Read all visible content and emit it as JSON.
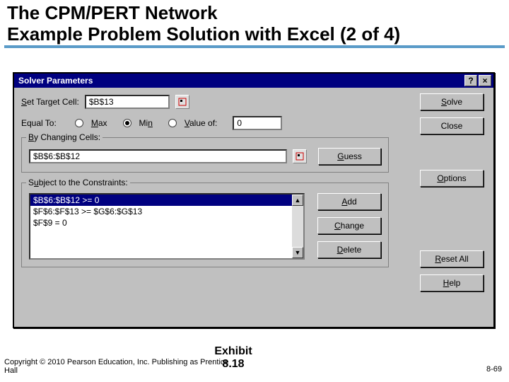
{
  "slide": {
    "title": "The CPM/PERT Network\nExample Problem Solution with Excel (2 of 4)"
  },
  "dialog": {
    "title": "Solver Parameters",
    "labels": {
      "set_target": "Set Target Cell:",
      "equal_to": "Equal To:",
      "max": "Max",
      "min": "Min",
      "value_of": "Value of:",
      "by_changing": "By Changing Cells:",
      "subject_to": "Subject to the Constraints:"
    },
    "values": {
      "target_cell": "$B$13",
      "value_of": "0",
      "changing_cells": "$B$6:$B$12"
    },
    "equal_to_selected": "min",
    "constraints": [
      "$B$6:$B$12 >= 0",
      "$F$6:$F$13 >= $G$6:$G$13",
      "$F$9 = 0"
    ],
    "buttons": {
      "solve": "Solve",
      "close": "Close",
      "guess": "Guess",
      "options": "Options",
      "add": "Add",
      "change": "Change",
      "delete": "Delete",
      "reset_all": "Reset All",
      "help": "Help"
    }
  },
  "footer": {
    "copyright": "Copyright © 2010 Pearson Education, Inc. Publishing as Prentice Hall",
    "exhibit": "Exhibit 8.18",
    "page": "8-69"
  }
}
